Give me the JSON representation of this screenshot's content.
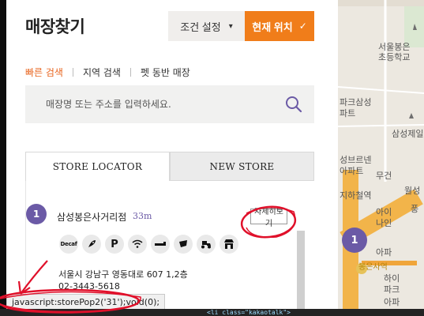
{
  "page_title": "매장찾기",
  "header": {
    "condition_button": "조건 설정",
    "current_location_button": "현재 위치",
    "check_glyph": "✓",
    "caret_glyph": "▾"
  },
  "search_tabs": [
    "빠른 검색",
    "지역 검색",
    "펫 동반 매장"
  ],
  "search": {
    "placeholder": "매장명 또는 주소를 입력하세요."
  },
  "store_tabs": [
    "STORE LOCATOR",
    "NEW STORE"
  ],
  "store": {
    "number": "1",
    "name": "삼성봉은사거리점",
    "distance": "33m",
    "detail_button": "자세히보기",
    "amenities": [
      {
        "name": "decaf",
        "label": "Decaf"
      },
      {
        "name": "rocket-icon",
        "label": ""
      },
      {
        "name": "parking",
        "label": "P"
      },
      {
        "name": "wifi-icon",
        "label": ""
      },
      {
        "name": "drive-icon",
        "label": ""
      },
      {
        "name": "cup-icon",
        "label": ""
      },
      {
        "name": "delivery-icon",
        "label": ""
      },
      {
        "name": "store-icon",
        "label": ""
      }
    ],
    "address": "서울시 강남구 영동대로 607 1,2층",
    "phone": "02-3443-5618"
  },
  "statusbar": {
    "text": "javascript:storePop2('31');void(0);"
  },
  "code_strip": "<li class=\"kakaotalk\">",
  "map": {
    "marker_number": "1",
    "labels": [
      "서울봉은",
      "초등학교",
      "파크삼성",
      "파트",
      "삼성제일",
      "성브르넨",
      "아파트",
      "무건",
      "지하철역",
      "월성",
      "풍",
      "아이",
      "나인",
      "아파",
      "봉은사역",
      "하이",
      "파크",
      "아파"
    ]
  }
}
